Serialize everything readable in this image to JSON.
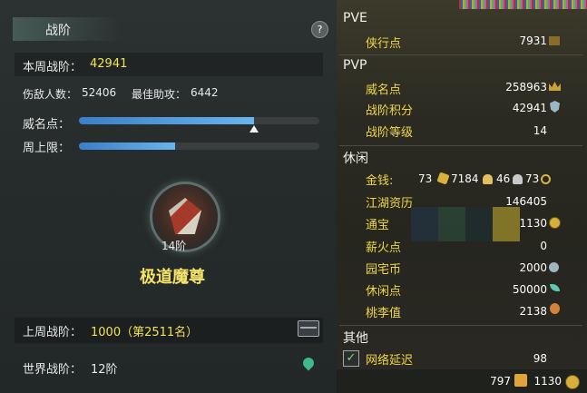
{
  "left": {
    "tab_title": "战阶",
    "help": "?",
    "week_label": "本周战阶：",
    "week_value": "42941",
    "kills_label": "伤敌人数：",
    "kills_value": "52406",
    "assist_label": "最佳助攻：",
    "assist_value": "6442",
    "prestige_label": "威名点：",
    "prestige_progress": 0.73,
    "weekly_cap_label": "周上限：",
    "weekly_cap_progress": 0.4,
    "rank_level": "14阶",
    "rank_title": "极道魔尊",
    "last_week_label": "上周战阶：",
    "last_week_value": "1000（第2511名）",
    "world_label": "世界战阶：",
    "world_value": "12阶"
  },
  "right": {
    "pve_header": "PVE",
    "pve_items": [
      {
        "label": "侠行点",
        "value": "7931",
        "icon": "cart-icon"
      }
    ],
    "pvp_header": "PVP",
    "pvp_items": [
      {
        "label": "威名点",
        "value": "258963",
        "icon": "crown-icon"
      },
      {
        "label": "战阶积分",
        "value": "42941",
        "icon": "shield-icon"
      },
      {
        "label": "战阶等级",
        "value": "14",
        "icon": ""
      }
    ],
    "leisure_header": "休闲",
    "money_label": "金钱:",
    "money_gold": "73",
    "money_silver": "7184",
    "money_copper1": "46",
    "money_copper2": "73",
    "leisure_items": [
      {
        "label": "江湖资历",
        "value": "146405",
        "icon": ""
      },
      {
        "label": "通宝",
        "value": "1130",
        "icon": "coin-icon"
      },
      {
        "label": "薪火点",
        "value": "0",
        "icon": ""
      },
      {
        "label": "园宅币",
        "value": "2000",
        "icon": "home-coin-icon"
      },
      {
        "label": "休闲点",
        "value": "50000",
        "icon": "leaf-icon"
      },
      {
        "label": "桃李值",
        "value": "2138",
        "icon": "peach-icon"
      }
    ],
    "other_header": "其他",
    "latency_label": "网络延迟",
    "latency_value": "98",
    "latency_checked": true,
    "bottom_left": "797",
    "bottom_right": "1130"
  }
}
